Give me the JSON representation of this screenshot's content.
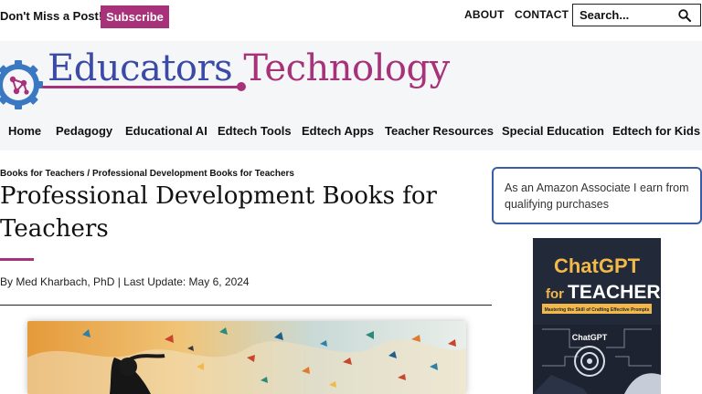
{
  "topbar": {
    "dont_miss": "Don't Miss a Post!",
    "subscribe_label": "Subscribe",
    "about_label": "ABOUT",
    "contact_label": "CONTACT",
    "search_placeholder": "Search..."
  },
  "brand": {
    "name_part1": "Educators",
    "name_part2": "Technology",
    "primary_color": "#3b4aa6",
    "accent_color": "#a83279"
  },
  "nav": {
    "items": [
      "Home",
      "Pedagogy",
      "Educational AI",
      "Edtech Tools",
      "Edtech Apps",
      "Teacher Resources",
      "Special Education",
      "Edtech for Kids"
    ]
  },
  "article": {
    "breadcrumb_1": "Books for Teachers",
    "breadcrumb_sep": "/",
    "breadcrumb_2": "Professional Development Books for Teachers",
    "title": "Professional Development Books for Teachers",
    "byline": "By Med Kharbach, PhD | Last Update: May 6, 2024"
  },
  "sidebar": {
    "notice": "As an Amazon Associate I earn from qualifying purchases",
    "book": {
      "title_line1": "ChatGPT",
      "title_line2": "for",
      "title_line3": "TEACHERS",
      "subtitle": "Mastering the Skill of Crafting Effective Prompts",
      "badge": "ChatGPT"
    }
  }
}
